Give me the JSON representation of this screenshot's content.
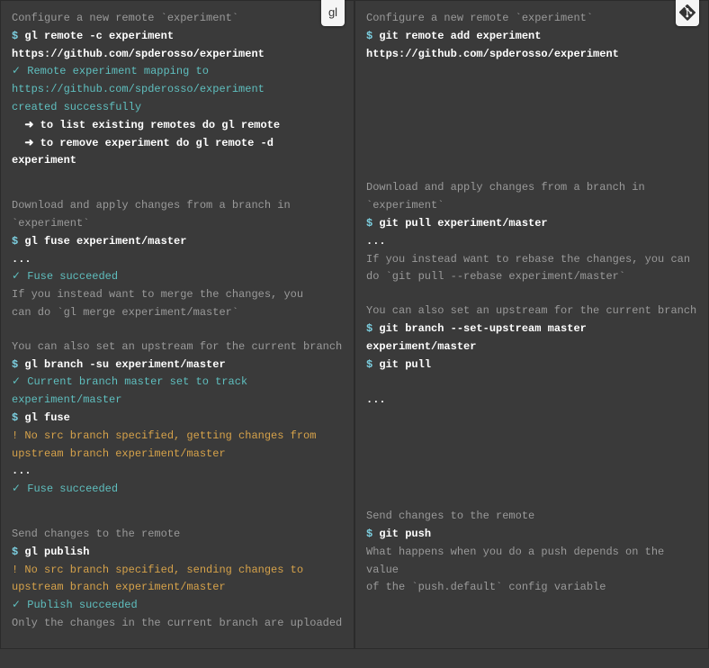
{
  "badges": {
    "gl": "gl"
  },
  "left": {
    "b1": {
      "desc": "Configure a new remote `experiment`",
      "prompt": "$",
      "cmd1a": "gl remote -c experiment",
      "cmd1b": "https://github.com/spderosso/experiment",
      "ok1": "✓ Remote experiment mapping to",
      "ok2": "https://github.com/spderosso/experiment",
      "ok3": "created successfully",
      "hint1": "  ➜ to list existing remotes do gl remote",
      "hint2": "  ➜ to remove experiment do gl remote -d experiment"
    },
    "b2": {
      "desc1": "Download and apply changes from a branch in",
      "desc2": "`experiment`",
      "cmd1": "gl fuse experiment/master",
      "dots": "...",
      "ok": "✓ Fuse succeeded",
      "note1": "If you instead want to merge the changes, you",
      "note2": "can do `gl merge experiment/master`"
    },
    "b3": {
      "desc": "You can also set an upstream for the current branch",
      "cmd1": "gl branch -su experiment/master",
      "ok1": "✓ Current branch master set to track",
      "ok2": "experiment/master",
      "cmd2": "gl fuse",
      "warn1": "! No src branch specified, getting changes from",
      "warn2": "upstream branch experiment/master",
      "dots": "...",
      "ok3": "✓ Fuse succeeded"
    },
    "b4": {
      "desc": "Send changes to the remote",
      "cmd1": "gl publish",
      "warn1": "! No src branch specified, sending changes to",
      "warn2": "upstream branch experiment/master",
      "ok": "✓ Publish succeeded",
      "note": "Only the changes in the current branch are uploaded"
    }
  },
  "right": {
    "b1": {
      "desc": "Configure a new remote `experiment`",
      "cmd1a": "git remote add experiment",
      "cmd1b": "https://github.com/spderosso/experiment"
    },
    "b2": {
      "desc1": "Download and apply changes from a branch in",
      "desc2": "`experiment`",
      "cmd1": "git pull experiment/master",
      "dots": "...",
      "note1": "If you instead want to rebase the changes, you can",
      "note2": "do `git pull --rebase experiment/master`"
    },
    "b3": {
      "desc": "You can also set an upstream for the current branch",
      "cmd1": "git branch --set-upstream master experiment/master",
      "cmd2": "git pull",
      "dots": "..."
    },
    "b4": {
      "desc": "Send changes to the remote",
      "cmd1": "git push",
      "note1": "What happens when you do a push depends on the value",
      "note2": "of the `push.default` config variable"
    }
  },
  "prompt": "$"
}
